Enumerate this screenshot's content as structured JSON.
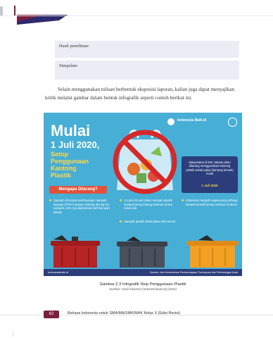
{
  "form": {
    "hasil_label": "Hasil penelitian:",
    "simpulan_label": "Simpulan:"
  },
  "paragraph": "Selain menggunakan tulisan berbentuk eksposisi laporan, kalian juga dapat menyajikan kritik melalui gambar dalam bentuk infografik seperti contoh berikut ini.",
  "infographic": {
    "logo_text": "Indonesia Baik.id",
    "headline_line1": "Mulai",
    "headline_line2": "1 Juli 2020,",
    "headline_line3": "Setop",
    "headline_line4": "Penggunaan",
    "headline_line5": "Kantong",
    "headline_line6": "Plastik",
    "box_text": "Masyarakat di DKI Jakarta akan dilarang menggunakan kantong plastik sekali pakai (kantong kresek) mulai",
    "box_date": "1 Juli 2020",
    "question": "Mengapa Dilarang?",
    "reasons": [
      "Sampah di tempat pembuangan sampah terpadu (TPST) Bantar Gebang 39 juta ton sampah, 34% nya didominasi oleh sampah plastik",
      "1,3 juta ton per tahun sampah plastik menjadi penyumbang terbesar di laut Indonesia",
      "Sampah plastik sekali pakai sulit terurai",
      "Indonesia menjadi negara penyumbang sampah plastik kedua terbesar di dunia"
    ],
    "footer_left": "Indonesiabaik.id",
    "footer_right": "Sumber: Info Kementerian Pemberdayaan Perempuan dan Perlindungan Anak"
  },
  "caption": {
    "title": "Gambar 2.3 Infografik Stop Penggunaan Plastik",
    "source": "Sumber: Hasil rekaman (Indonesiabaik.id) (2022)"
  },
  "footer": {
    "page_number": "62",
    "text": "Bahasa Indonesia untuk SMA/MA/SMK/MAK Kelas X (Edisi Revisi)"
  },
  "colors": {
    "accent": "#7a1f3d",
    "infographic_bg": "#47aed6",
    "headline_yellow": "#ffd84a"
  }
}
